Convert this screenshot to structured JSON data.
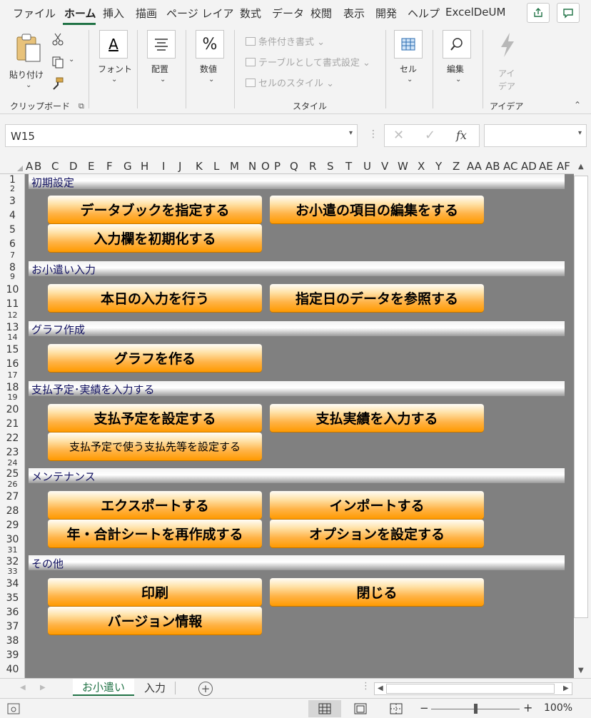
{
  "ribbon_tabs": [
    "ファイル",
    "ホーム",
    "挿入",
    "描画",
    "ページ レイアウ",
    "数式",
    "データ",
    "校閲",
    "表示",
    "開発",
    "ヘルプ",
    "ExcelDeUM"
  ],
  "clipboard": {
    "paste": "貼り付け",
    "group": "クリップボード"
  },
  "font": {
    "label": "フォント",
    "glyph": "A"
  },
  "alignment": {
    "label": "配置"
  },
  "number": {
    "label": "数値",
    "glyph": "%"
  },
  "styles": {
    "conditional": "条件付き書式",
    "table": "テーブルとして書式設定",
    "cell_styles": "セルのスタイル",
    "group": "スタイル"
  },
  "cells": {
    "label": "セル"
  },
  "editing": {
    "label": "編集"
  },
  "ideas": {
    "label_line1": "アイ",
    "label_line2": "デア",
    "group": "アイデア"
  },
  "formula_bar": {
    "name_box": "W15",
    "fx": "fx",
    "formula": ""
  },
  "columns": [
    "A",
    "B",
    "C",
    "D",
    "E",
    "F",
    "G",
    "H",
    "I",
    "J",
    "K",
    "L",
    "M",
    "N",
    "O",
    "P",
    "Q",
    "R",
    "S",
    "T",
    "U",
    "V",
    "W",
    "X",
    "Y",
    "Z",
    "AA",
    "AB",
    "AC",
    "AD",
    "AE",
    "AF"
  ],
  "rows": [
    "1",
    "2",
    "3",
    "4",
    "5",
    "6",
    "7",
    "8",
    "9",
    "10",
    "11",
    "12",
    "13",
    "14",
    "15",
    "16",
    "17",
    "18",
    "19",
    "20",
    "21",
    "22",
    "23",
    "24",
    "25",
    "26",
    "27",
    "28",
    "29",
    "30",
    "31",
    "32",
    "33",
    "34",
    "35",
    "36",
    "37",
    "38",
    "39",
    "40"
  ],
  "sections": [
    {
      "title": "初期設定",
      "buttons": [
        "データブックを指定する",
        "お小遣の項目の編集をする",
        "入力欄を初期化する"
      ]
    },
    {
      "title": "お小遣い入力",
      "buttons": [
        "本日の入力を行う",
        "指定日のデータを参照する"
      ]
    },
    {
      "title": "グラフ作成",
      "buttons": [
        "グラフを作る"
      ]
    },
    {
      "title": "支払予定･実績を入力する",
      "buttons": [
        "支払予定を設定する",
        "支払実績を入力する",
        "支払予定で使う支払先等を設定する"
      ]
    },
    {
      "title": "メンテナンス",
      "buttons": [
        "エクスポートする",
        "インポートする",
        "年・合計シートを再作成する",
        "オプションを設定する"
      ]
    },
    {
      "title": "その他",
      "buttons": [
        "印刷",
        "閉じる",
        "バージョン情報"
      ]
    }
  ],
  "sheet_tabs": [
    "お小遣い",
    "入力"
  ],
  "status": {
    "zoom": "100%",
    "zoom_minus": "−",
    "zoom_plus": "+"
  },
  "colors": {
    "accent": "#217346",
    "sheet_bg": "#808080",
    "button_orange": "#ff9a00",
    "section_text": "#101060"
  }
}
